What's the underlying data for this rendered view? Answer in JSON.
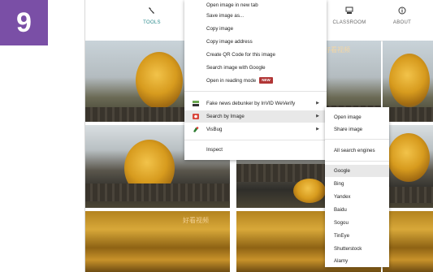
{
  "step_number": "9",
  "topnav": {
    "items": [
      {
        "label": "TOOLS",
        "icon": "wrench-icon"
      },
      {
        "label": "CLASSROOM",
        "icon": "classroom-icon"
      },
      {
        "label": "ABOUT",
        "icon": "info-icon"
      }
    ]
  },
  "watermark_text": "好看视频",
  "context_menu": {
    "items": [
      {
        "label": "Open image in new tab"
      },
      {
        "label": "Save image as..."
      },
      {
        "label": "Copy image"
      },
      {
        "label": "Copy image address"
      },
      {
        "label": "Create QR Code for this image"
      },
      {
        "label": "Search image with Google"
      },
      {
        "label": "Open in reading mode",
        "badge": "NEW"
      }
    ],
    "extensions": [
      {
        "label": "Fake news debunker by InVID  WeVerify",
        "icon": "weverify-icon",
        "has_submenu": true
      },
      {
        "label": "Search by Image",
        "icon": "search-by-image-icon",
        "has_submenu": true
      },
      {
        "label": "VisBug",
        "icon": "visbug-icon",
        "has_submenu": true
      }
    ],
    "inspect": "Inspect"
  },
  "submenu": {
    "items": [
      "Open image",
      "Share image"
    ],
    "all_engines": "All search engines",
    "engines": [
      "Google",
      "Bing",
      "Yandex",
      "Baidu",
      "Sogou",
      "TinEye",
      "Shutterstock",
      "Alamy"
    ]
  },
  "colors": {
    "accent_badge": "#7a4fa6",
    "new_badge": "#b13636",
    "tools_accent": "#2a8a8c"
  }
}
